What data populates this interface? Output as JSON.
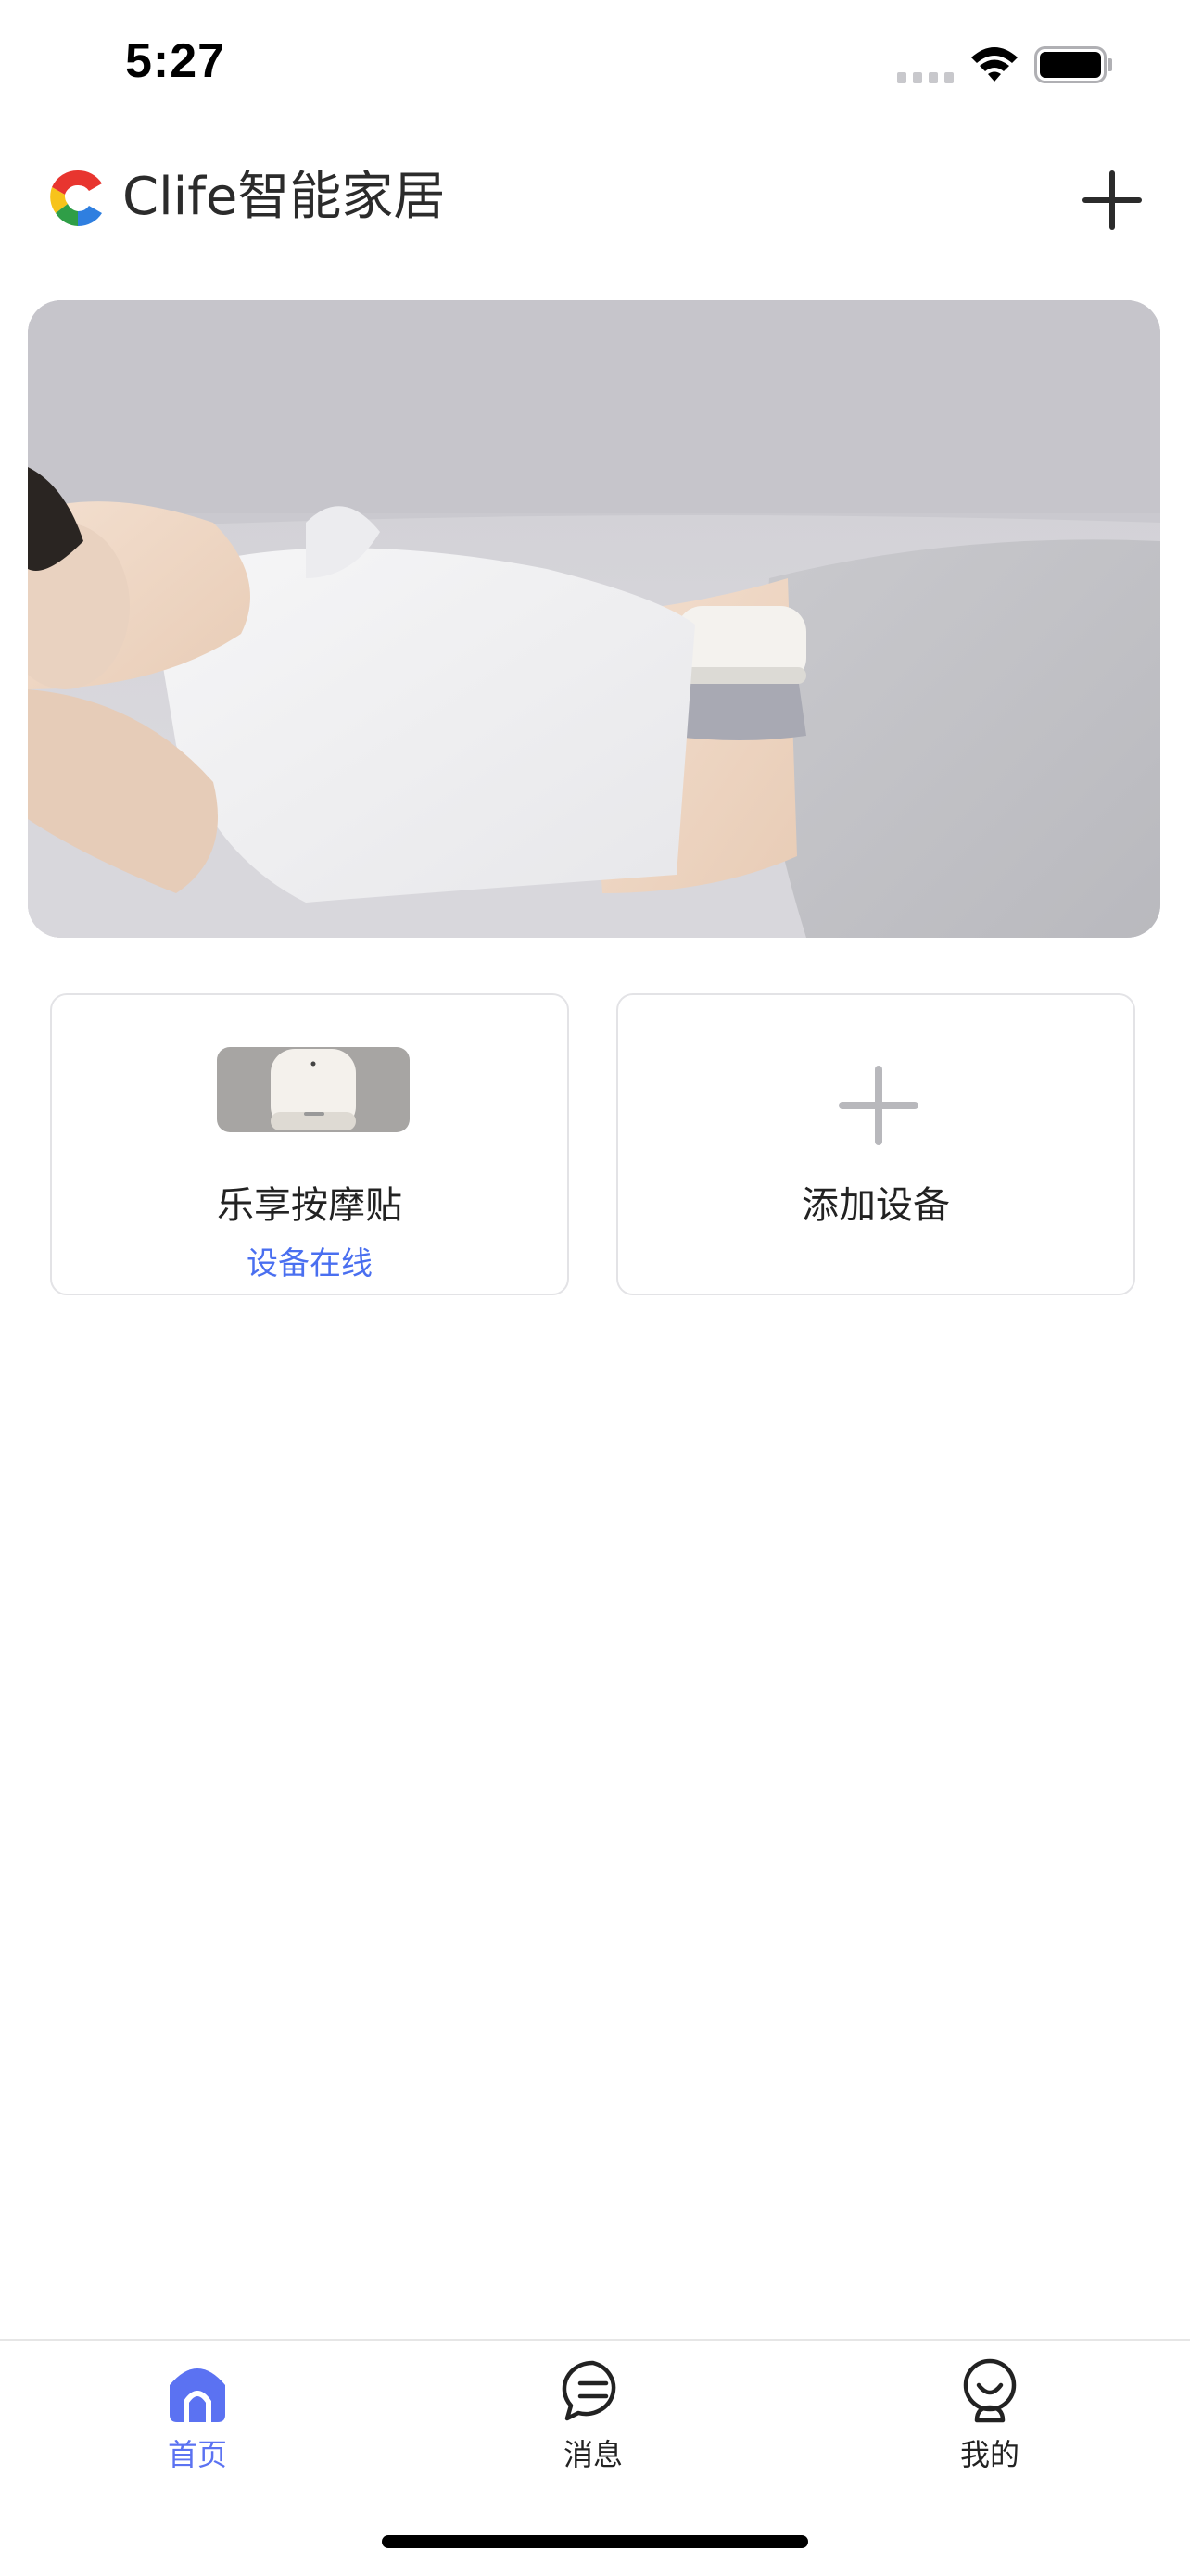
{
  "status_bar": {
    "time": "5:27",
    "signal_icon": "cellular-signal-icon",
    "wifi_icon": "wifi-icon",
    "battery_icon": "battery-icon"
  },
  "header": {
    "logo_icon": "clife-logo",
    "title": "Clife智能家居",
    "add_icon": "plus-icon"
  },
  "banner": {
    "image": "person lying on sofa wearing massage patch"
  },
  "devices": [
    {
      "name": "乐享按摩贴",
      "status": "设备在线",
      "status_color": "#4a6ff0",
      "icon": "massage-patch-device-icon"
    }
  ],
  "add_device": {
    "label": "添加设备",
    "icon": "plus-icon"
  },
  "tab_bar": {
    "active_color": "#5b72f2",
    "tabs": [
      {
        "label": "首页",
        "icon": "home-icon",
        "active": true
      },
      {
        "label": "消息",
        "icon": "message-icon",
        "active": false
      },
      {
        "label": "我的",
        "icon": "profile-icon",
        "active": false
      }
    ]
  }
}
